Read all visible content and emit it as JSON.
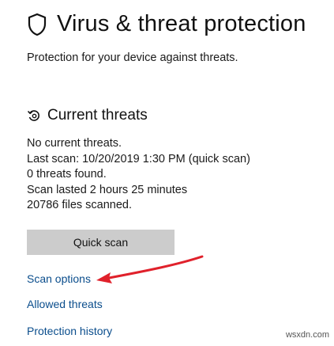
{
  "header": {
    "title": "Virus & threat protection",
    "subtitle": "Protection for your device against threats.",
    "icon": "shield-icon"
  },
  "current_threats": {
    "title": "Current threats",
    "icon": "threats-refresh-icon",
    "lines": [
      "No current threats.",
      "Last scan: 10/20/2019 1:30 PM (quick scan)",
      "0 threats found.",
      "Scan lasted 2 hours 25 minutes",
      "20786 files scanned."
    ],
    "quick_scan_label": "Quick scan"
  },
  "links": {
    "scan_options": "Scan options",
    "allowed_threats": "Allowed threats",
    "protection_history": "Protection history"
  },
  "annotation": {
    "arrow_color": "#e0212b"
  },
  "watermark": "wsxdn.com"
}
